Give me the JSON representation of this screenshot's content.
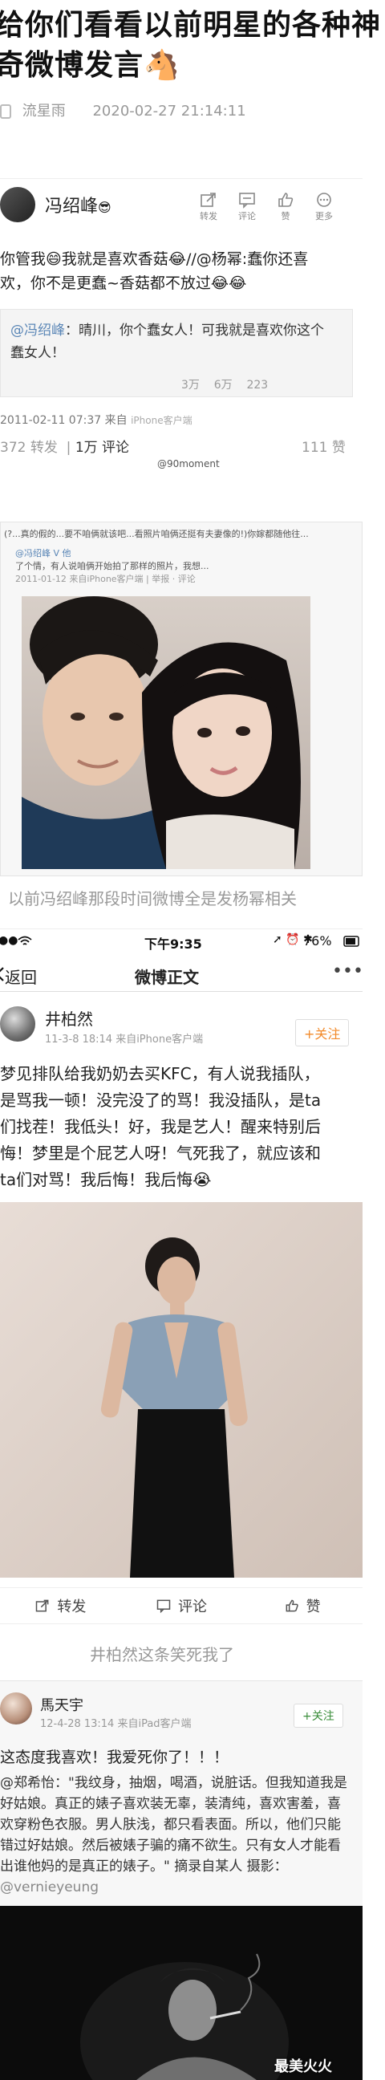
{
  "article": {
    "title_line1": "给你们看看以前明星的各种神",
    "title_line2": "奇微博发言🐴",
    "author": "流星雨",
    "datetime": "2020-02-27 21:14:11"
  },
  "post1": {
    "username": "冯绍峰",
    "badge": "😎",
    "actions": [
      {
        "label": "转发",
        "icon": "repost-icon"
      },
      {
        "label": "评论",
        "icon": "comment-icon"
      },
      {
        "label": "赞",
        "icon": "like-icon"
      },
      {
        "label": "更多",
        "icon": "more-icon"
      }
    ],
    "text_line1": "你管我😄我就是喜欢香菇😂//@杨幂:蠢你还喜",
    "text_line2": "欢，你不是更蠢~香菇都不放过😂😂",
    "quote_mention": "@冯绍峰",
    "quote_line1": "：晴川，你个蠢女人！可我就是喜欢你这个",
    "quote_line2": "蠢女人！",
    "quote_stats": {
      "repost": "3万",
      "comment": "6万",
      "like": "223"
    },
    "source_time": "2011-02-11 07:37",
    "source_label": "来自",
    "source_device": "iPhone客户端",
    "repost_count": "372 转发",
    "comment_count": "1万 评论",
    "like_count": "111 赞",
    "watermark": "@90moment"
  },
  "post2": {
    "header_line": "(?...真的假的...要不咱俩就该吧...看照片咱俩还挺有夫妻像的!)你嫁都随他往...",
    "username": "冯绍峰",
    "sub_line1": "@冯绍峰 V 他",
    "sub_line2": "了个情，有人说咱俩开始拍了那样的照片，我想...",
    "sub_line3": "2011-01-12 来自iPhone客户端 | 举报 · 评论",
    "caption": "以前冯绍峰那段时间微博全是发杨幂相关"
  },
  "phone": {
    "time": "下午9:35",
    "battery": "76%",
    "back_label": "返回",
    "nav_title": "微博正文",
    "username": "井柏然",
    "meta": "11-3-8 18:14  来自iPhone客户端",
    "follow_label": "+关注",
    "text_lines": [
      "梦见排队给我奶奶去买KFC，有人说我插队，",
      "是骂我一顿！没完没了的骂！我没插队，是ta",
      "们找茬！我低头！好，我是艺人！醒来特别后",
      "悔！梦里是个屁艺人呀！气死我了，就应该和",
      "ta们对骂！我后悔！我后悔😭"
    ],
    "toolbar": [
      {
        "label": "转发",
        "icon": "repost-icon"
      },
      {
        "label": "评论",
        "icon": "comment-icon"
      },
      {
        "label": "赞",
        "icon": "like-icon"
      }
    ],
    "caption": "井柏然这条笑死我了"
  },
  "post3": {
    "username": "馬天宇",
    "meta": "12-4-28 13:14  来自iPad客户端",
    "follow_label": "+关注",
    "headline": "这态度我喜欢！我爱死你了！！！",
    "text_lines": [
      "@郑希怡：\"我纹身，抽烟，喝酒，说脏话。但我知道我是",
      "好姑娘。真正的婊子喜欢装无辜，装清纯，喜欢害羞，喜",
      "欢穿粉色衣服。男人肤浅，都只看表面。所以，他们只能",
      "错过好姑娘。然后被婊子骗的痛不欲生。只有女人才能看",
      "出谁他妈的是真正的婊子。\" 摘录自某人  摄影：",
      "@vernieyeung"
    ],
    "brand_watermark": "最美火火"
  }
}
